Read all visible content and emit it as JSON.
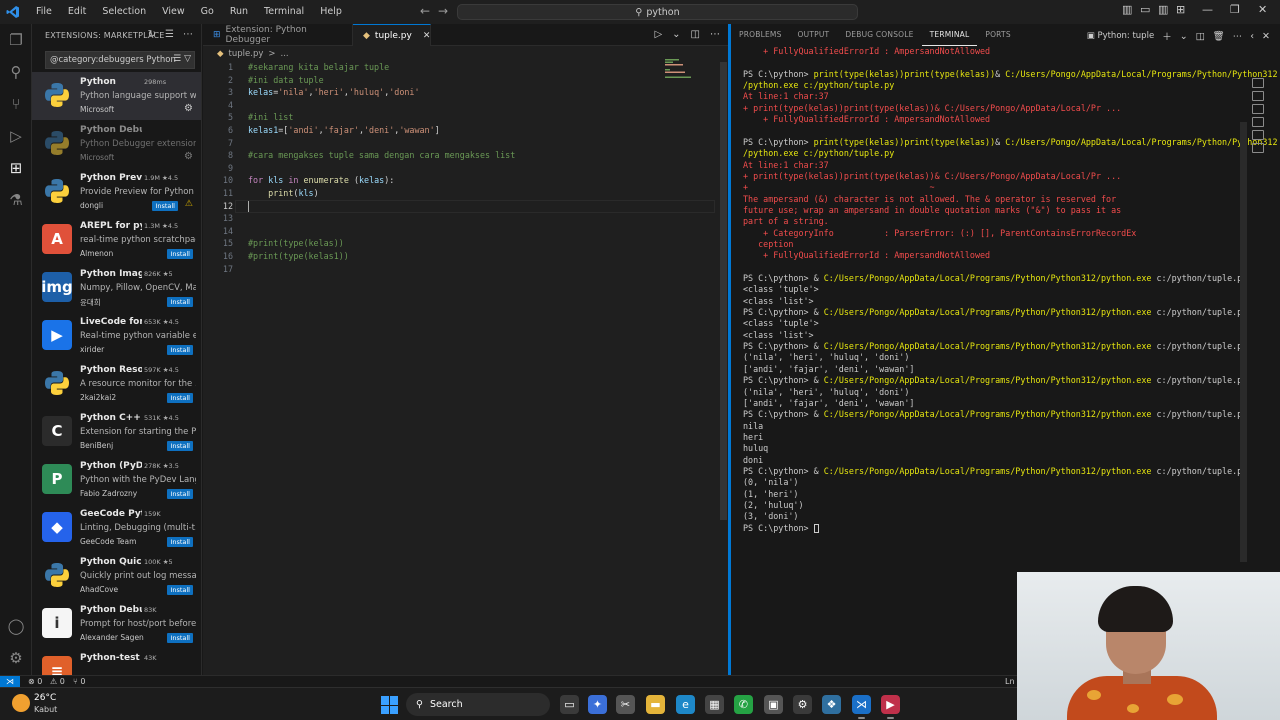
{
  "titlebar": {
    "menu": [
      "File",
      "Edit",
      "Selection",
      "View",
      "Go",
      "Run",
      "Terminal",
      "Help"
    ],
    "search_text": "python"
  },
  "sidebar": {
    "title": "EXTENSIONS: MARKETPLACE",
    "search_value": "@category:debuggers Python",
    "extensions": [
      {
        "name": "Python",
        "stats": "298ms",
        "desc": "Python language support wi...",
        "author": "Microsoft",
        "action": "gear",
        "selected": true,
        "icon_color": "#3776ab",
        "icon_glyph": "py"
      },
      {
        "name": "Python Debugger",
        "stats": "",
        "desc": "Python Debugger extension...",
        "author": "Microsoft",
        "action": "gear",
        "dim": true,
        "icon_color": "#3776ab",
        "icon_glyph": "py"
      },
      {
        "name": "Python Previ...",
        "stats": "1.9M ★4.5",
        "desc": "Provide Preview for Python ...",
        "author": "dongli",
        "action": "install-warn",
        "icon_color": "#3776ab",
        "icon_glyph": "py"
      },
      {
        "name": "AREPL for pyt...",
        "stats": "1.3M ★4.5",
        "desc": "real-time python scratchpad",
        "author": "Almenon",
        "action": "install",
        "icon_color": "#e0513a",
        "icon_glyph": "A"
      },
      {
        "name": "Python Image...",
        "stats": "826K ★5",
        "desc": "Numpy, Pillow, OpenCV, Ma...",
        "author": "윤대희",
        "action": "install",
        "icon_color": "#1d5fa8",
        "icon_glyph": "img"
      },
      {
        "name": "LiveCode for ...",
        "stats": "653K ★4.5",
        "desc": "Real-time python variable e...",
        "author": "xirider",
        "action": "install",
        "icon_color": "#1a73e8",
        "icon_glyph": "▶"
      },
      {
        "name": "Python Reso...",
        "stats": "597K ★4.5",
        "desc": "A resource monitor for the ...",
        "author": "2kai2kai2",
        "action": "install",
        "icon_color": "#3776ab",
        "icon_glyph": "py"
      },
      {
        "name": "Python C++ ...",
        "stats": "531K ★4.5",
        "desc": "Extension for starting the Py...",
        "author": "BeniBenj",
        "action": "install",
        "icon_color": "#2b2b2b",
        "icon_glyph": "C"
      },
      {
        "name": "Python (PyD...",
        "stats": "278K ★3.5",
        "desc": "Python with the PyDev Lang...",
        "author": "Fabio Zadrozny",
        "action": "install",
        "icon_color": "#2e8b57",
        "icon_glyph": "P"
      },
      {
        "name": "GeeCode Python",
        "stats": "159K",
        "desc": "Linting, Debugging (multi-t...",
        "author": "GeeCode Team",
        "action": "install",
        "icon_color": "#2563eb",
        "icon_glyph": "◆"
      },
      {
        "name": "Python Quick ...",
        "stats": "100K ★5",
        "desc": "Quickly print out log messa...",
        "author": "AhadCove",
        "action": "install",
        "icon_color": "#111111",
        "icon_glyph": "py"
      },
      {
        "name": "Python Debuggin...",
        "stats": "83K",
        "desc": "Prompt for host/port before...",
        "author": "Alexander Sagen",
        "action": "install",
        "icon_color": "#f5f5f5",
        "icon_glyph": "i"
      },
      {
        "name": "Python-test",
        "stats": "43K",
        "desc": "",
        "author": "",
        "action": "",
        "icon_color": "#e0602a",
        "icon_glyph": "≡"
      }
    ],
    "install_label": "Install"
  },
  "editor": {
    "tabs": [
      {
        "label": "Extension: Python Debugger",
        "active": false
      },
      {
        "label": "tuple.py",
        "active": true
      }
    ],
    "breadcrumb": [
      "tuple.py",
      ">",
      "..."
    ],
    "current_line": 12,
    "lines": [
      {
        "n": "1",
        "tokens": [
          {
            "t": "#sekarang kita belajar tuple",
            "c": "com"
          }
        ]
      },
      {
        "n": "2",
        "tokens": [
          {
            "t": "#ini data tuple",
            "c": "com"
          }
        ]
      },
      {
        "n": "3",
        "tokens": [
          {
            "t": "kelas",
            "c": "var"
          },
          {
            "t": "=",
            "c": "def"
          },
          {
            "t": "'nila'",
            "c": "str"
          },
          {
            "t": ",",
            "c": "def"
          },
          {
            "t": "'heri'",
            "c": "str"
          },
          {
            "t": ",",
            "c": "def"
          },
          {
            "t": "'huluq'",
            "c": "str"
          },
          {
            "t": ",",
            "c": "def"
          },
          {
            "t": "'doni'",
            "c": "str"
          }
        ]
      },
      {
        "n": "4",
        "tokens": []
      },
      {
        "n": "5",
        "tokens": [
          {
            "t": "#ini list",
            "c": "com"
          }
        ]
      },
      {
        "n": "6",
        "tokens": [
          {
            "t": "kelas1",
            "c": "var"
          },
          {
            "t": "=[",
            "c": "def"
          },
          {
            "t": "'andi'",
            "c": "str"
          },
          {
            "t": ",",
            "c": "def"
          },
          {
            "t": "'fajar'",
            "c": "str"
          },
          {
            "t": ",",
            "c": "def"
          },
          {
            "t": "'deni'",
            "c": "str"
          },
          {
            "t": ",",
            "c": "def"
          },
          {
            "t": "'wawan'",
            "c": "str"
          },
          {
            "t": "]",
            "c": "def"
          }
        ]
      },
      {
        "n": "7",
        "tokens": []
      },
      {
        "n": "8",
        "tokens": [
          {
            "t": "#cara mengakses tuple sama dengan cara mengakses list",
            "c": "com"
          }
        ]
      },
      {
        "n": "9",
        "tokens": []
      },
      {
        "n": "10",
        "tokens": [
          {
            "t": "for",
            "c": "kw"
          },
          {
            "t": " ",
            "c": "def"
          },
          {
            "t": "kls",
            "c": "var"
          },
          {
            "t": " ",
            "c": "def"
          },
          {
            "t": "in",
            "c": "kw"
          },
          {
            "t": " ",
            "c": "def"
          },
          {
            "t": "enumerate",
            "c": "fn"
          },
          {
            "t": " (",
            "c": "def"
          },
          {
            "t": "kelas",
            "c": "var"
          },
          {
            "t": "):",
            "c": "def"
          }
        ]
      },
      {
        "n": "11",
        "tokens": [
          {
            "t": "    ",
            "c": "def"
          },
          {
            "t": "print",
            "c": "fn"
          },
          {
            "t": "(",
            "c": "def"
          },
          {
            "t": "kls",
            "c": "var"
          },
          {
            "t": ")",
            "c": "def"
          }
        ]
      },
      {
        "n": "12",
        "tokens": []
      },
      {
        "n": "13",
        "tokens": []
      },
      {
        "n": "14",
        "tokens": []
      },
      {
        "n": "15",
        "tokens": [
          {
            "t": "#print(type(kelas))",
            "c": "com"
          }
        ]
      },
      {
        "n": "16",
        "tokens": [
          {
            "t": "#print(type(kelas1))",
            "c": "com"
          }
        ]
      },
      {
        "n": "17",
        "tokens": []
      }
    ]
  },
  "panel": {
    "tabs": [
      "PROBLEMS",
      "OUTPUT",
      "DEBUG CONSOLE",
      "TERMINAL",
      "PORTS"
    ],
    "active_tab": "TERMINAL",
    "terminal_selector": "Python: tuple",
    "lines": [
      {
        "segs": [
          {
            "t": "    + FullyQualifiedErrorId : AmpersandNotAllowed",
            "c": "err"
          }
        ]
      },
      {
        "segs": [
          {
            "t": "",
            "c": "arg"
          }
        ]
      },
      {
        "segs": [
          {
            "t": "PS C:\\python> ",
            "c": "arg"
          },
          {
            "t": "print(type(kelas))print(type(kelas))",
            "c": "cmd"
          },
          {
            "t": "& ",
            "c": "arg"
          },
          {
            "t": "C:/Users/Pongo/AppData/Local/Programs/Python/Python312",
            "c": "cmd"
          }
        ]
      },
      {
        "segs": [
          {
            "t": "/python.exe c:/python/tuple.py",
            "c": "cmd"
          }
        ]
      },
      {
        "segs": [
          {
            "t": "At line:1 char:37",
            "c": "err"
          }
        ]
      },
      {
        "segs": [
          {
            "t": "+ print(type(kelas))print(type(kelas))& C:/Users/Pongo/AppData/Local/Pr ...",
            "c": "err"
          }
        ]
      },
      {
        "segs": [
          {
            "t": "    + FullyQualifiedErrorId : AmpersandNotAllowed",
            "c": "err"
          }
        ]
      },
      {
        "segs": [
          {
            "t": "",
            "c": "arg"
          }
        ]
      },
      {
        "segs": [
          {
            "t": "PS C:\\python> ",
            "c": "arg"
          },
          {
            "t": "print(type(kelas))print(type(kelas))",
            "c": "cmd"
          },
          {
            "t": "& ",
            "c": "arg"
          },
          {
            "t": "C:/Users/Pongo/AppData/Local/Programs/Python/Python312",
            "c": "cmd"
          }
        ]
      },
      {
        "segs": [
          {
            "t": "/python.exe c:/python/tuple.py",
            "c": "cmd"
          }
        ]
      },
      {
        "segs": [
          {
            "t": "At line:1 char:37",
            "c": "err"
          }
        ]
      },
      {
        "segs": [
          {
            "t": "+ print(type(kelas))print(type(kelas))& C:/Users/Pongo/AppData/Local/Pr ...",
            "c": "err"
          }
        ]
      },
      {
        "segs": [
          {
            "t": "+                                    ~",
            "c": "err"
          }
        ]
      },
      {
        "segs": [
          {
            "t": "The ampersand (&) character is not allowed. The & operator is reserved for",
            "c": "err"
          }
        ]
      },
      {
        "segs": [
          {
            "t": "future use; wrap an ampersand in double quotation marks (\"&\") to pass it as",
            "c": "err"
          }
        ]
      },
      {
        "segs": [
          {
            "t": "part of a string.",
            "c": "err"
          }
        ]
      },
      {
        "segs": [
          {
            "t": "    + CategoryInfo          : ParserError: (:) [], ParentContainsErrorRecordEx",
            "c": "err"
          }
        ]
      },
      {
        "segs": [
          {
            "t": "   ception",
            "c": "err"
          }
        ]
      },
      {
        "segs": [
          {
            "t": "    + FullyQualifiedErrorId : AmpersandNotAllowed",
            "c": "err"
          }
        ]
      },
      {
        "segs": [
          {
            "t": "",
            "c": "arg"
          }
        ]
      },
      {
        "segs": [
          {
            "t": "PS C:\\python> ",
            "c": "arg"
          },
          {
            "t": "& ",
            "c": "arg"
          },
          {
            "t": "C:/Users/Pongo/AppData/Local/Programs/Python/Python312/python.exe",
            "c": "cmd"
          },
          {
            "t": " c:/python/tuple.py",
            "c": "arg"
          }
        ]
      },
      {
        "segs": [
          {
            "t": "<class 'tuple'>",
            "c": "arg"
          }
        ]
      },
      {
        "segs": [
          {
            "t": "<class 'list'>",
            "c": "arg"
          }
        ]
      },
      {
        "segs": [
          {
            "t": "PS C:\\python> ",
            "c": "arg"
          },
          {
            "t": "& ",
            "c": "arg"
          },
          {
            "t": "C:/Users/Pongo/AppData/Local/Programs/Python/Python312/python.exe",
            "c": "cmd"
          },
          {
            "t": " c:/python/tuple.py",
            "c": "arg"
          }
        ]
      },
      {
        "segs": [
          {
            "t": "<class 'tuple'>",
            "c": "arg"
          }
        ]
      },
      {
        "segs": [
          {
            "t": "<class 'list'>",
            "c": "arg"
          }
        ]
      },
      {
        "segs": [
          {
            "t": "PS C:\\python> ",
            "c": "arg"
          },
          {
            "t": "& ",
            "c": "arg"
          },
          {
            "t": "C:/Users/Pongo/AppData/Local/Programs/Python/Python312/python.exe",
            "c": "cmd"
          },
          {
            "t": " c:/python/tuple.py",
            "c": "arg"
          }
        ]
      },
      {
        "segs": [
          {
            "t": "('nila', 'heri', 'huluq', 'doni')",
            "c": "arg"
          }
        ]
      },
      {
        "segs": [
          {
            "t": "['andi', 'fajar', 'deni', 'wawan']",
            "c": "arg"
          }
        ]
      },
      {
        "segs": [
          {
            "t": "PS C:\\python> ",
            "c": "arg"
          },
          {
            "t": "& ",
            "c": "arg"
          },
          {
            "t": "C:/Users/Pongo/AppData/Local/Programs/Python/Python312/python.exe",
            "c": "cmd"
          },
          {
            "t": " c:/python/tuple.py",
            "c": "arg"
          }
        ]
      },
      {
        "segs": [
          {
            "t": "('nila', 'heri', 'huluq', 'doni')",
            "c": "arg"
          }
        ]
      },
      {
        "segs": [
          {
            "t": "['andi', 'fajar', 'deni', 'wawan']",
            "c": "arg"
          }
        ]
      },
      {
        "segs": [
          {
            "t": "PS C:\\python> ",
            "c": "arg"
          },
          {
            "t": "& ",
            "c": "arg"
          },
          {
            "t": "C:/Users/Pongo/AppData/Local/Programs/Python/Python312/python.exe",
            "c": "cmd"
          },
          {
            "t": " c:/python/tuple.py",
            "c": "arg"
          }
        ]
      },
      {
        "segs": [
          {
            "t": "nila",
            "c": "arg"
          }
        ]
      },
      {
        "segs": [
          {
            "t": "heri",
            "c": "arg"
          }
        ]
      },
      {
        "segs": [
          {
            "t": "huluq",
            "c": "arg"
          }
        ]
      },
      {
        "segs": [
          {
            "t": "doni",
            "c": "arg"
          }
        ]
      },
      {
        "segs": [
          {
            "t": "PS C:\\python> ",
            "c": "arg"
          },
          {
            "t": "& ",
            "c": "arg"
          },
          {
            "t": "C:/Users/Pongo/AppData/Local/Programs/Python/Python312/python.exe",
            "c": "cmd"
          },
          {
            "t": " c:/python/tuple.py",
            "c": "arg"
          }
        ]
      },
      {
        "segs": [
          {
            "t": "(0, 'nila')",
            "c": "arg"
          }
        ]
      },
      {
        "segs": [
          {
            "t": "(1, 'heri')",
            "c": "arg"
          }
        ]
      },
      {
        "segs": [
          {
            "t": "(2, 'huluq')",
            "c": "arg"
          }
        ]
      },
      {
        "segs": [
          {
            "t": "(3, 'doni')",
            "c": "arg"
          }
        ]
      },
      {
        "segs": [
          {
            "t": "PS C:\\python> ",
            "c": "arg"
          }
        ],
        "cursor": true
      }
    ]
  },
  "statusbar": {
    "errors": "⊗ 0",
    "warnings": "⚠ 0",
    "ports": "⑂ 0",
    "right": "Ln"
  },
  "taskbar": {
    "temp": "26°C",
    "condition": "Kabut",
    "search": "Search"
  },
  "colors": {
    "accent": "#0078d4",
    "error": "#f14c4c",
    "command": "#e5e510",
    "comment": "#6a9955",
    "string": "#ce9178"
  }
}
